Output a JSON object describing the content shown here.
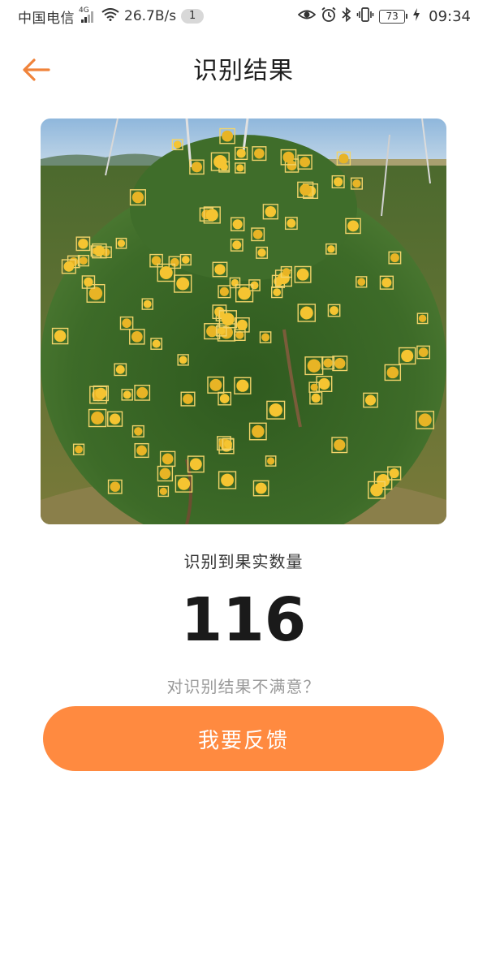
{
  "status_bar": {
    "carrier": "中国电信",
    "network": "4G",
    "speed": "26.7B/s",
    "notification_count": "1",
    "battery": "73",
    "time": "09:34",
    "icons": [
      "signal-icon",
      "wifi-icon",
      "eye-icon",
      "alarm-icon",
      "bluetooth-icon",
      "vibrate-icon",
      "charging-icon"
    ]
  },
  "header": {
    "title": "识别结果",
    "back_icon": "arrow-left-icon",
    "accent_color": "#F0833A"
  },
  "result": {
    "image_description_icon": "fruit-detection-image",
    "count_label": "识别到果实数量",
    "count_value": "116",
    "dissatisfied_text": "对识别结果不满意？",
    "feedback_button": "我要反馈",
    "button_color": "#FF8A40"
  }
}
